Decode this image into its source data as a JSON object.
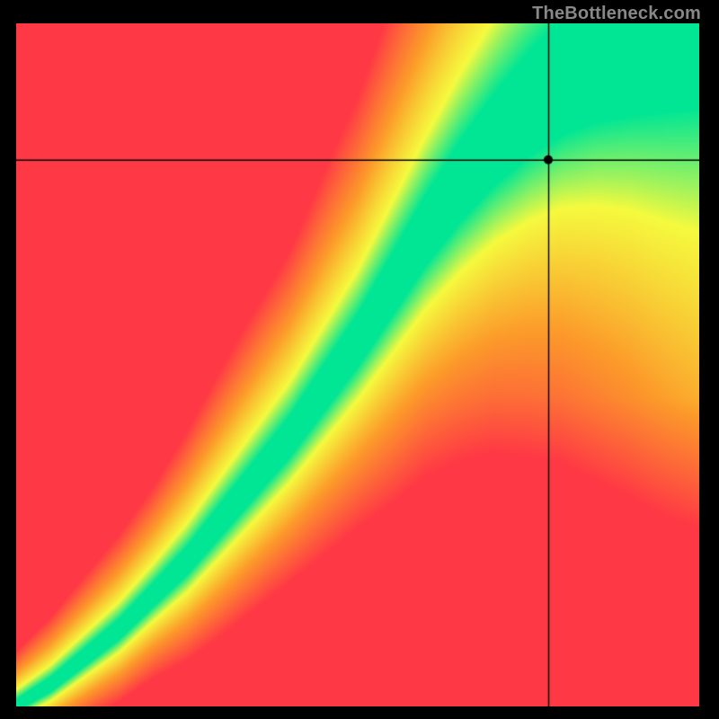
{
  "watermark": "TheBottleneck.com",
  "chart_data": {
    "type": "heatmap",
    "title": "",
    "xlabel": "",
    "ylabel": "",
    "xlim": [
      0,
      1
    ],
    "ylim": [
      0,
      1
    ],
    "colors": {
      "optimal": "#00E695",
      "near": "#F5FA3E",
      "medium": "#FC9B2A",
      "poor": "#FE3845"
    },
    "crosshair": {
      "x": 0.78,
      "y": 0.8
    },
    "crosshair_dot_radius": 5,
    "ridge_samples": [
      {
        "x": 0.0,
        "y": 0.0
      },
      {
        "x": 0.05,
        "y": 0.03
      },
      {
        "x": 0.1,
        "y": 0.07
      },
      {
        "x": 0.15,
        "y": 0.11
      },
      {
        "x": 0.2,
        "y": 0.16
      },
      {
        "x": 0.25,
        "y": 0.21
      },
      {
        "x": 0.3,
        "y": 0.27
      },
      {
        "x": 0.35,
        "y": 0.33
      },
      {
        "x": 0.4,
        "y": 0.39
      },
      {
        "x": 0.45,
        "y": 0.46
      },
      {
        "x": 0.5,
        "y": 0.53
      },
      {
        "x": 0.55,
        "y": 0.61
      },
      {
        "x": 0.6,
        "y": 0.69
      },
      {
        "x": 0.65,
        "y": 0.76
      },
      {
        "x": 0.7,
        "y": 0.82
      },
      {
        "x": 0.75,
        "y": 0.87
      },
      {
        "x": 0.8,
        "y": 0.91
      },
      {
        "x": 0.85,
        "y": 0.94
      },
      {
        "x": 0.9,
        "y": 0.96
      },
      {
        "x": 0.95,
        "y": 0.98
      },
      {
        "x": 1.0,
        "y": 1.0
      }
    ],
    "band_width_samples": [
      {
        "x": 0.0,
        "w": 0.01
      },
      {
        "x": 0.1,
        "w": 0.015
      },
      {
        "x": 0.2,
        "w": 0.02
      },
      {
        "x": 0.3,
        "w": 0.028
      },
      {
        "x": 0.4,
        "w": 0.035
      },
      {
        "x": 0.5,
        "w": 0.045
      },
      {
        "x": 0.6,
        "w": 0.06
      },
      {
        "x": 0.7,
        "w": 0.078
      },
      {
        "x": 0.8,
        "w": 0.1
      },
      {
        "x": 0.9,
        "w": 0.13
      },
      {
        "x": 1.0,
        "w": 0.17
      }
    ]
  }
}
